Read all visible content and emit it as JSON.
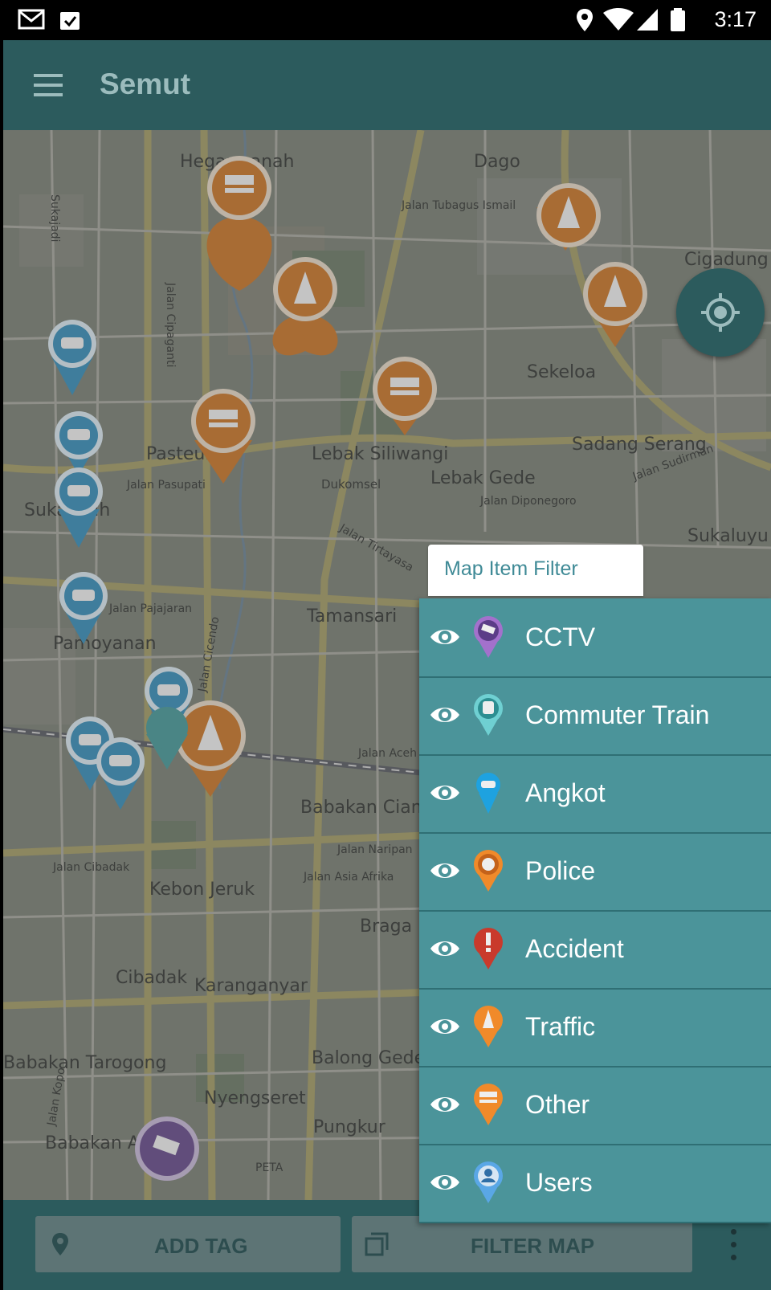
{
  "status_bar": {
    "time": "3:17"
  },
  "app_bar": {
    "title": "Semut"
  },
  "map": {
    "labels": [
      {
        "text": "Dago"
      },
      {
        "text": "Hegarmanah"
      },
      {
        "text": "Jalan Tubagus Ismail"
      },
      {
        "text": "Cigadung"
      },
      {
        "text": "Sekeloa"
      },
      {
        "text": "Sadang Serang"
      },
      {
        "text": "Lebak Siliwangi"
      },
      {
        "text": "Lebak Gede"
      },
      {
        "text": "Dukomsel"
      },
      {
        "text": "Jalan Diponegoro"
      },
      {
        "text": "Jalan Pasupati"
      },
      {
        "text": "Pasteur"
      },
      {
        "text": "Sukajadi"
      },
      {
        "text": "Sukagalih"
      },
      {
        "text": "Jalan Pajajaran"
      },
      {
        "text": "Pamoyanan"
      },
      {
        "text": "Tamansari"
      },
      {
        "text": "Jalan Tirtayasa"
      },
      {
        "text": "Jalan Cipaganti"
      },
      {
        "text": "Jalan Cicendo"
      },
      {
        "text": "Babakan Ciamis"
      },
      {
        "text": "Jalan Aceh"
      },
      {
        "text": "Jalan Naripan"
      },
      {
        "text": "Jalan Asia Afrika"
      },
      {
        "text": "Kebon Jeruk"
      },
      {
        "text": "Braga"
      },
      {
        "text": "Jalan Cibadak"
      },
      {
        "text": "Cibadak"
      },
      {
        "text": "Karanganyar"
      },
      {
        "text": "Babakan Tarogong"
      },
      {
        "text": "Balong Gede"
      },
      {
        "text": "Nyengseret"
      },
      {
        "text": "Pungkur"
      },
      {
        "text": "Babakan Asih"
      },
      {
        "text": "Sukaluyu"
      },
      {
        "text": "Jalan Sudirman"
      },
      {
        "text": "Jalan Kopo"
      },
      {
        "text": "PETA"
      }
    ]
  },
  "filter": {
    "title": "Map Item Filter",
    "items": [
      {
        "label": "CCTV",
        "icon": "cctv-pin-icon",
        "color": "#a371cc"
      },
      {
        "label": "Commuter Train",
        "icon": "train-pin-icon",
        "color": "#6fd0d2"
      },
      {
        "label": "Angkot",
        "icon": "angkot-pin-icon",
        "color": "#1ea2e0"
      },
      {
        "label": "Police",
        "icon": "police-pin-icon",
        "color": "#f08a2a"
      },
      {
        "label": "Accident",
        "icon": "accident-pin-icon",
        "color": "#c93a2c"
      },
      {
        "label": "Traffic",
        "icon": "traffic-cone-pin-icon",
        "color": "#f08a2a"
      },
      {
        "label": "Other",
        "icon": "barrier-pin-icon",
        "color": "#f08a2a"
      },
      {
        "label": "Users",
        "icon": "user-pin-icon",
        "color": "#5aa7e6"
      }
    ]
  },
  "bottom_bar": {
    "add_tag": "ADD TAG",
    "filter_map": "FILTER MAP"
  },
  "colors": {
    "app_bar": "#2c5b5d",
    "filter_panel": "#4b949a",
    "marker_orange": "#c9782e",
    "marker_blue": "#3c8fb8"
  }
}
